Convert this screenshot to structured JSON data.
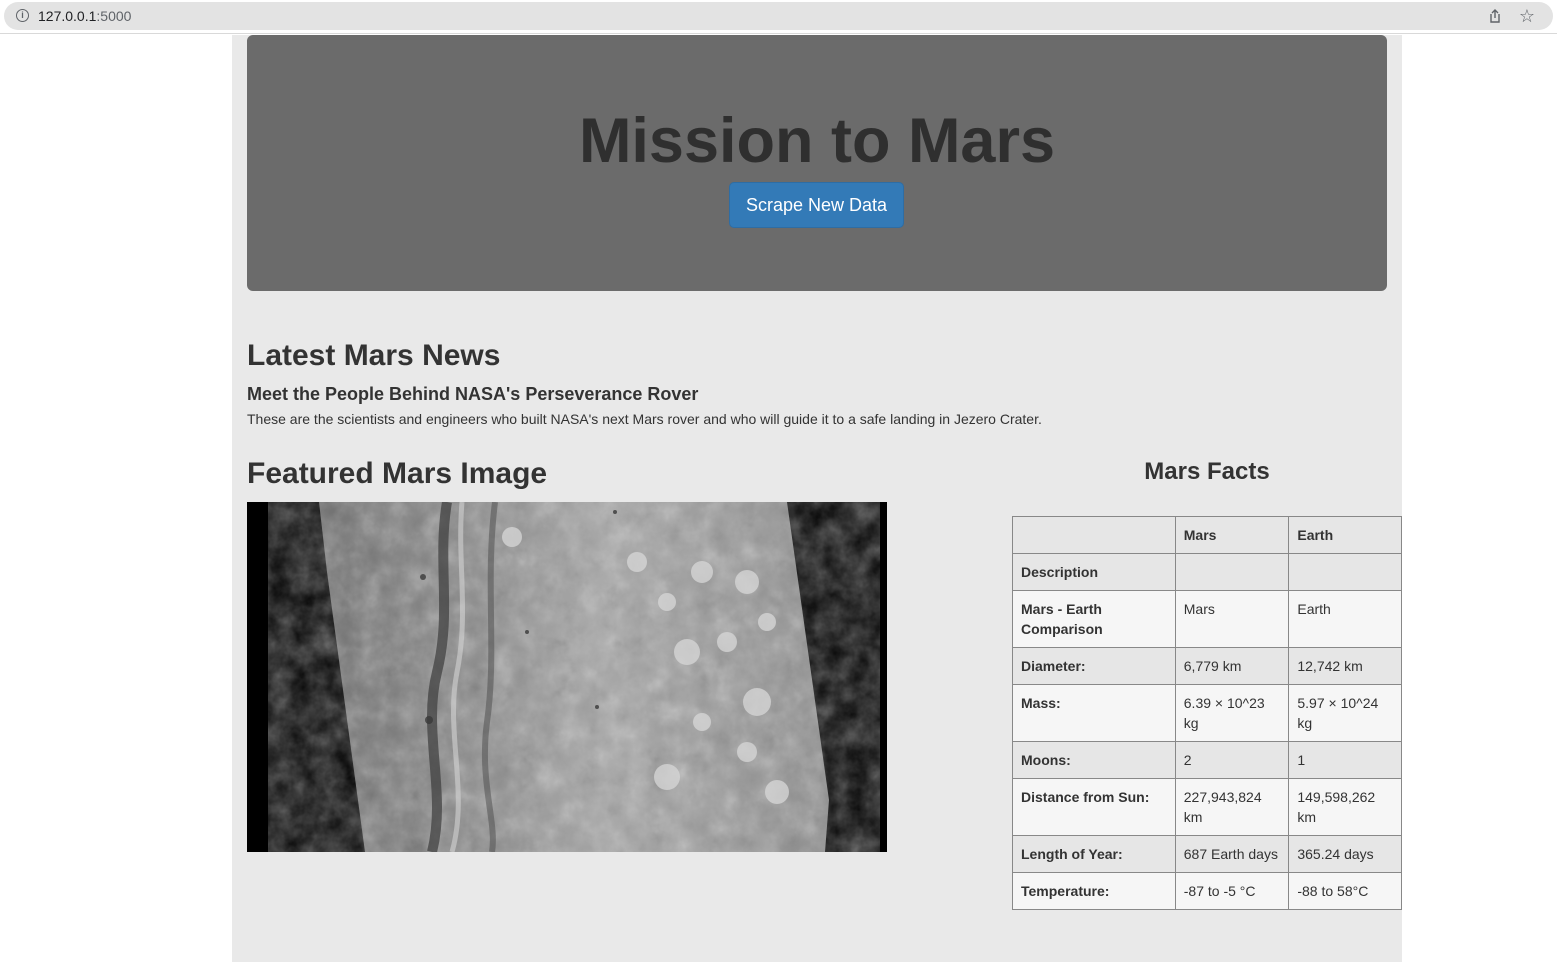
{
  "browser": {
    "url_host": "127.0.0.1",
    "url_port": ":5000"
  },
  "hero": {
    "title": "Mission to Mars",
    "button_label": "Scrape New Data"
  },
  "news": {
    "heading": "Latest Mars News",
    "title": "Meet the People Behind NASA's Perseverance Rover",
    "teaser": "These are the scientists and engineers who built NASA's next Mars rover and who will guide it to a safe landing in Jezero Crater."
  },
  "featured": {
    "heading": "Featured Mars Image"
  },
  "facts": {
    "heading": "Mars Facts",
    "columns": [
      "",
      "Mars",
      "Earth"
    ],
    "rows": [
      {
        "label": "Description",
        "mars": "",
        "earth": ""
      },
      {
        "label": "Mars - Earth Comparison",
        "mars": "Mars",
        "earth": "Earth"
      },
      {
        "label": "Diameter:",
        "mars": "6,779 km",
        "earth": "12,742 km"
      },
      {
        "label": "Mass:",
        "mars": "6.39 × 10^23 kg",
        "earth": "5.97 × 10^24 kg"
      },
      {
        "label": "Moons:",
        "mars": "2",
        "earth": "1"
      },
      {
        "label": "Distance from Sun:",
        "mars": "227,943,824 km",
        "earth": "149,598,262 km"
      },
      {
        "label": "Length of Year:",
        "mars": "687 Earth days",
        "earth": "365.24 days"
      },
      {
        "label": "Temperature:",
        "mars": "-87 to -5 °C",
        "earth": "-88 to 58°C"
      }
    ]
  },
  "colors": {
    "jumbotron_bg": "#6b6b6b",
    "button_bg": "#337ab7",
    "page_bg": "#e9e9e9"
  }
}
